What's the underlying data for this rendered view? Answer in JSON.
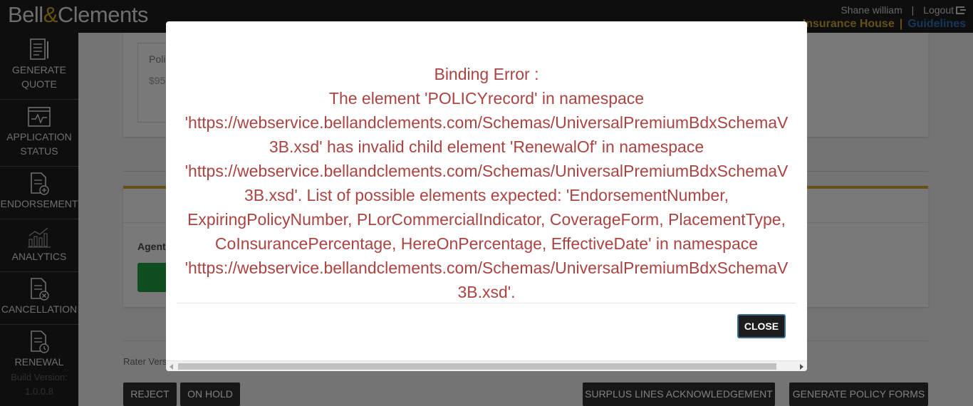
{
  "header": {
    "logo_part1": "Bell",
    "logo_amp": "&",
    "logo_part2": "Clements",
    "user_name": "Shane william",
    "separator": "|",
    "logout_label": "Logout",
    "org_name": "Insurance House",
    "guidelines_label": "Guidelines"
  },
  "sidebar": {
    "items": [
      {
        "label_line1": "GENERATE",
        "label_line2": "QUOTE",
        "icon": "generate-quote-icon"
      },
      {
        "label_line1": "APPLICATION",
        "label_line2": "STATUS",
        "icon": "application-status-icon"
      },
      {
        "label_line1": "ENDORSEMENT",
        "label_line2": "",
        "icon": "endorsement-icon"
      },
      {
        "label_line1": "ANALYTICS",
        "label_line2": "",
        "icon": "analytics-icon"
      },
      {
        "label_line1": "CANCELLATION",
        "label_line2": "",
        "icon": "cancellation-icon"
      },
      {
        "label_line1": "RENEWAL",
        "label_line2": "",
        "icon": "renewal-icon"
      }
    ],
    "build_label": "Build Version:",
    "build_version": "1.0.0.8"
  },
  "page": {
    "policy_label_partial": "Poli",
    "amount_partial": "$95",
    "agent_label_partial": "Agent",
    "rater_label_partial": "Rater Vers",
    "reject_label": "REJECT",
    "on_hold_label": "ON HOLD",
    "surplus_label": "SURPLUS LINES ACKNOWLEDGEMENT",
    "generate_forms_label": "GENERATE POLICY FORMS"
  },
  "modal": {
    "error_lines": [
      "Binding Error :",
      "The element 'POLICYrecord' in namespace",
      "'https://webservice.bellandclements.com/Schemas/UniversalPremiumBdxSchemaV",
      "3B.xsd' has invalid child element 'RenewalOf' in namespace",
      "'https://webservice.bellandclements.com/Schemas/UniversalPremiumBdxSchemaV",
      "3B.xsd'. List of possible elements expected: 'EndorsementNumber,",
      "ExpiringPolicyNumber, PLorCommercialIndicator, CoverageForm, PlacementType,",
      "CoInsurancePercentage, HereOnPercentage, EffectiveDate' in namespace",
      "'https://webservice.bellandclements.com/Schemas/UniversalPremiumBdxSchemaV",
      "3B.xsd'."
    ],
    "close_label": "CLOSE"
  },
  "colors": {
    "header_bg": "#1c1c1c",
    "brand_gold": "#c9a227",
    "link_blue": "#2e6eb5",
    "error_red": "#a94442",
    "success_green": "#1a9b3d"
  }
}
